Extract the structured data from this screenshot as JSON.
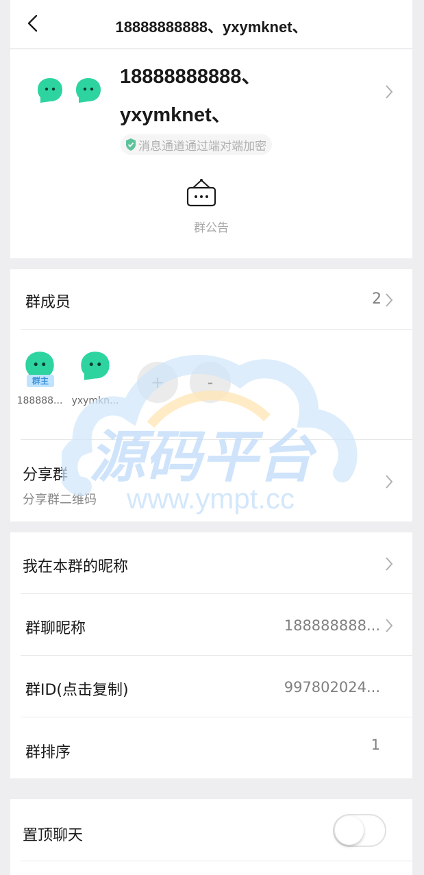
{
  "nav": {
    "title": "18888888888、yxymknet、"
  },
  "header": {
    "name_line1": "18888888888、",
    "name_line2": "yxymknet、",
    "e2e_text": "消息通道通过端对端加密",
    "notice_label": "群公告"
  },
  "members": {
    "title": "群成员",
    "count": "2",
    "list": [
      {
        "name": "188888...",
        "badge": "群主"
      },
      {
        "name": "yxymkn..."
      }
    ],
    "add_label": "+",
    "remove_label": "-"
  },
  "share": {
    "title": "分享群",
    "subtitle": "分享群二维码"
  },
  "settings": {
    "my_nickname_label": "我在本群的昵称",
    "group_nickname_label": "群聊昵称",
    "group_nickname_value": "188888888...",
    "group_id_label": "群ID(点击复制)",
    "group_id_value": "997802024...",
    "sort_label": "群排序",
    "sort_value": "1"
  },
  "pin": {
    "label": "置顶聊天",
    "enabled": false
  },
  "watermark": {
    "title": "源码平台",
    "url": "www.ympt.cc"
  },
  "colors": {
    "avatar": "#2dd4a0",
    "badge_bg": "#bfe4ff",
    "badge_text": "#3a8fd9"
  }
}
